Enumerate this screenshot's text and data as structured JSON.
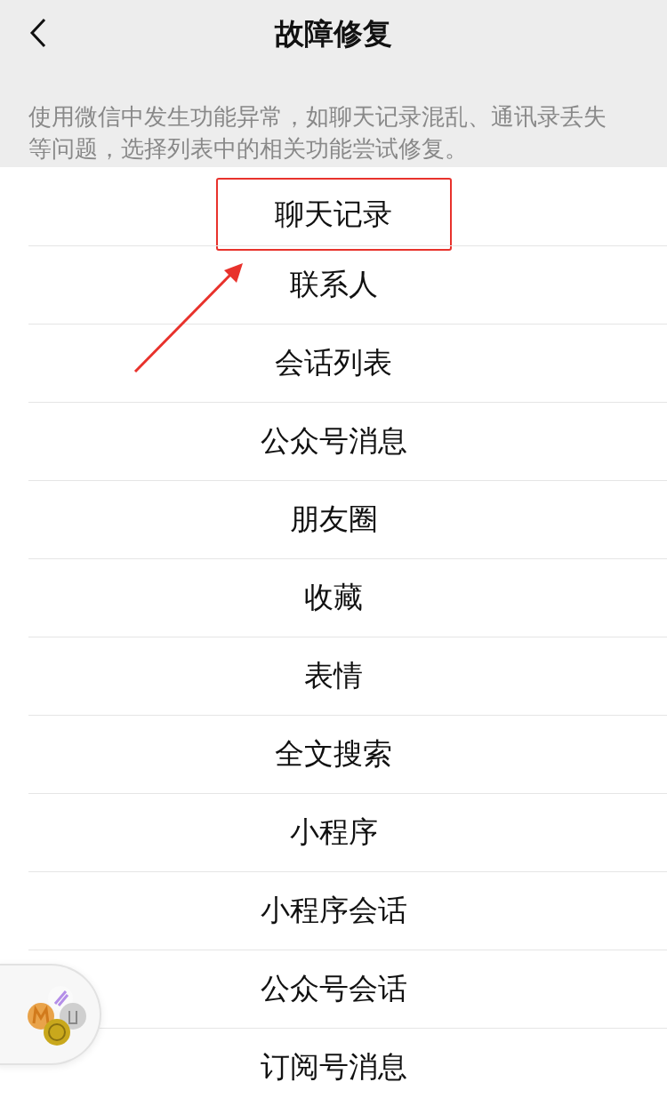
{
  "header": {
    "title": "故障修复"
  },
  "description": "使用微信中发生功能异常，如聊天记录混乱、通讯录丢失等问题，选择列表中的相关功能尝试修复。",
  "items": [
    {
      "label": "聊天记录",
      "highlighted": true
    },
    {
      "label": "联系人",
      "highlighted": false
    },
    {
      "label": "会话列表",
      "highlighted": false
    },
    {
      "label": "公众号消息",
      "highlighted": false
    },
    {
      "label": "朋友圈",
      "highlighted": false
    },
    {
      "label": "收藏",
      "highlighted": false
    },
    {
      "label": "表情",
      "highlighted": false
    },
    {
      "label": "全文搜索",
      "highlighted": false
    },
    {
      "label": "小程序",
      "highlighted": false
    },
    {
      "label": "小程序会话",
      "highlighted": false
    },
    {
      "label": "公众号会话",
      "highlighted": false
    },
    {
      "label": "订阅号消息",
      "highlighted": false
    }
  ]
}
